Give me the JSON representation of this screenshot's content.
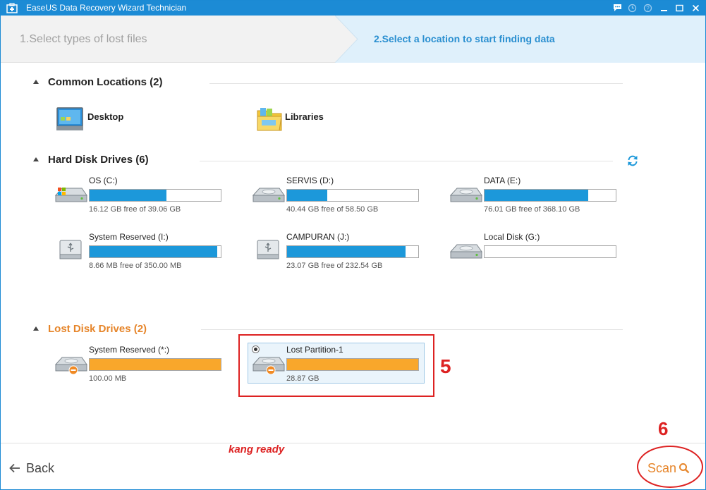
{
  "window": {
    "title": "EaseUS Data Recovery Wizard Technician"
  },
  "steps": {
    "step1": "1.Select types of lost files",
    "step2": "2.Select a location to start finding data"
  },
  "common_locations": {
    "title": "Common Locations (2)",
    "items": [
      {
        "label": "Desktop",
        "icon": "desktop-icon"
      },
      {
        "label": "Libraries",
        "icon": "folder-icon"
      }
    ]
  },
  "hard_disk_drives": {
    "title": "Hard Disk Drives (6)",
    "drives": [
      {
        "name": "OS (C:)",
        "size": "16.12 GB free of 39.06 GB",
        "used_fraction": 0.587,
        "icon": "windows-drive-icon"
      },
      {
        "name": "SERVIS (D:)",
        "size": "40.44 GB free of 58.50 GB",
        "used_fraction": 0.309,
        "icon": "hard-drive-icon"
      },
      {
        "name": "DATA (E:)",
        "size": "76.01 GB free of 368.10 GB",
        "used_fraction": 0.793,
        "icon": "hard-drive-icon"
      },
      {
        "name": "System Reserved (I:)",
        "size": "8.66 MB free of 350.00 MB",
        "used_fraction": 0.975,
        "icon": "usb-drive-icon"
      },
      {
        "name": "CAMPURAN (J:)",
        "size": "23.07 GB free of 232.54 GB",
        "used_fraction": 0.901,
        "icon": "usb-drive-icon"
      },
      {
        "name": "Local Disk (G:)",
        "size": "",
        "used_fraction": 0.0,
        "icon": "hard-drive-icon"
      }
    ]
  },
  "lost_disk_drives": {
    "title": "Lost Disk Drives (2)",
    "drives": [
      {
        "name": "System Reserved (*:)",
        "size": "100.00 MB",
        "used_fraction": 1.0,
        "icon": "lost-drive-icon"
      },
      {
        "name": "Lost Partition-1",
        "size": "28.87 GB",
        "used_fraction": 1.0,
        "icon": "lost-drive-icon",
        "selected": true
      }
    ]
  },
  "annotations": {
    "step5": "5",
    "step6": "6",
    "watermark": "kang ready"
  },
  "footer": {
    "back_label": "Back",
    "scan_label": "Scan"
  },
  "colors": {
    "accent_blue": "#1c98da",
    "lost_orange": "#f9a72b",
    "scan_orange": "#e6852a",
    "annotation_red": "#dd2222"
  }
}
